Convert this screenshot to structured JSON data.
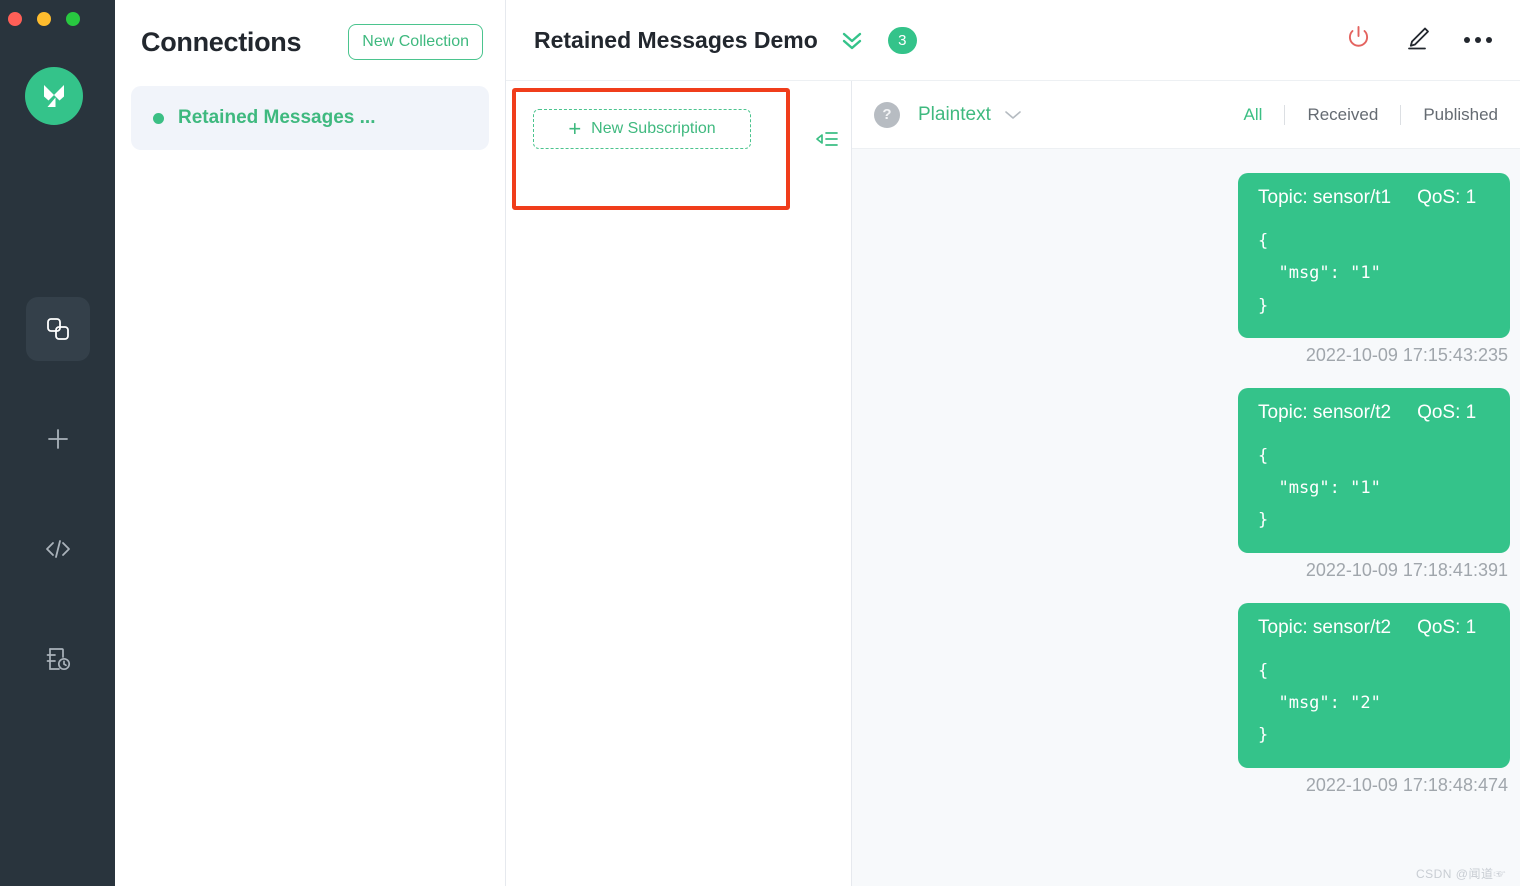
{
  "window": {
    "traffic_lights": [
      "close",
      "minimize",
      "maximize"
    ],
    "accent_green": "#34c38a",
    "highlight_red": "#f03d1b",
    "rail_bg": "#29343d"
  },
  "rail": {
    "logo_name": "mqttx-logo",
    "items": [
      {
        "name": "connections-icon",
        "active": true
      },
      {
        "name": "new-connection-plus-icon",
        "active": false
      },
      {
        "name": "script-code-icon",
        "active": false
      },
      {
        "name": "log-history-icon",
        "active": false
      }
    ]
  },
  "connections": {
    "title": "Connections",
    "new_collection_label": "New Collection",
    "items": [
      {
        "name": "Retained Messages ...",
        "status": "connected"
      }
    ]
  },
  "main": {
    "title": "Retained Messages Demo",
    "collapse_all_icon": "chevron-double-down-icon",
    "message_count": "3",
    "actions": [
      {
        "name": "disconnect-power-button",
        "icon": "power-icon",
        "color": "#e4635f"
      },
      {
        "name": "edit-connection-button",
        "icon": "pencil-icon",
        "color": "#22272e"
      },
      {
        "name": "more-options-button",
        "icon": "ellipsis-icon",
        "color": "#22272e"
      }
    ]
  },
  "subscriptions": {
    "new_subscription_label": "New Subscription",
    "new_subscription_plus": "+",
    "collapse_icon": "collapse-left-icon",
    "highlighted": true
  },
  "messages_toolbar": {
    "help_icon_label": "?",
    "format": "Plaintext",
    "format_chevron": "chevron-down-icon",
    "filters": [
      {
        "label": "All",
        "active": true
      },
      {
        "label": "Received",
        "active": false
      },
      {
        "label": "Published",
        "active": false
      }
    ]
  },
  "messages": [
    {
      "topic_label": "Topic: sensor/t1",
      "qos_label": "QoS: 1",
      "payload": "{\n  \"msg\": \"1\"\n}",
      "time": "2022-10-09 17:15:43:235"
    },
    {
      "topic_label": "Topic: sensor/t2",
      "qos_label": "QoS: 1",
      "payload": "{\n  \"msg\": \"1\"\n}",
      "time": "2022-10-09 17:18:41:391"
    },
    {
      "topic_label": "Topic: sensor/t2",
      "qos_label": "QoS: 1",
      "payload": "{\n  \"msg\": \"2\"\n}",
      "time": "2022-10-09 17:18:48:474"
    }
  ],
  "watermark": "CSDN @闻道☞"
}
